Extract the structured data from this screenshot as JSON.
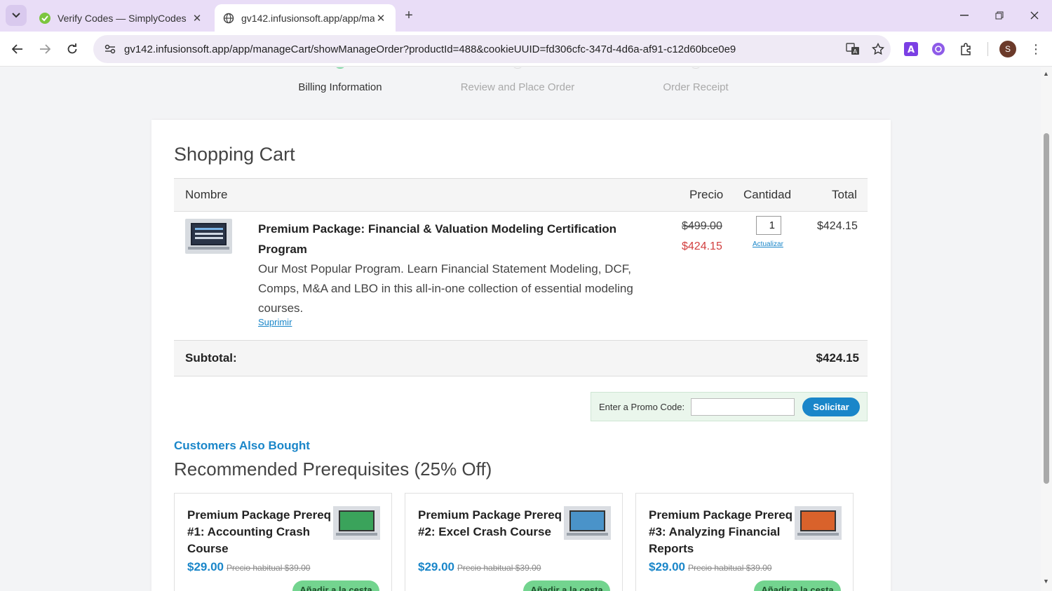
{
  "browser": {
    "tabs": [
      {
        "title": "Verify Codes — SimplyCodes",
        "active": false
      },
      {
        "title": "gv142.infusionsoft.app/app/ma",
        "active": true
      }
    ],
    "url": "gv142.infusionsoft.app/app/manageCart/showManageOrder?productId=488&cookieUUID=fd306cfc-347d-4d6a-af91-c12d60bce0e9",
    "avatar_initial": "S",
    "colors": {
      "tabbar": "#e9ddf7",
      "omnibox": "#efeaf5"
    }
  },
  "steps": [
    {
      "label": "Billing Information",
      "state": "done"
    },
    {
      "label": "Review and Place Order",
      "state": "todo"
    },
    {
      "label": "Order Receipt",
      "state": "todo"
    }
  ],
  "cart": {
    "title": "Shopping Cart",
    "columns": {
      "name": "Nombre",
      "price": "Precio",
      "quantity": "Cantidad",
      "total": "Total"
    },
    "item": {
      "name": "Premium Package: Financial & Valuation Modeling Certification Program",
      "description": "Our Most Popular Program. Learn Financial Statement Modeling, DCF, Comps, M&A and LBO in this all-in-one collection of essential modeling courses.",
      "delete_label": "Suprimir",
      "price_original": "$499.00",
      "price_sale": "$424.15",
      "quantity": "1",
      "update_label": "Actualizar",
      "line_total": "$424.15"
    },
    "subtotal_label": "Subtotal:",
    "subtotal_value": "$424.15",
    "promo": {
      "label": "Enter a Promo Code:",
      "value": "",
      "button": "Solicitar"
    }
  },
  "recommendations": {
    "kicker": "Customers Also Bought",
    "title": "Recommended Prerequisites (25% Off)",
    "items": [
      {
        "name": "Premium Package Prereq #1: Accounting Crash Course",
        "price": "$29.00",
        "regular": "Precio habitual $39.00",
        "button": "Añadir a la cesta",
        "screen_color": "#3aa35b"
      },
      {
        "name": "Premium Package Prereq #2: Excel Crash Course",
        "price": "$29.00",
        "regular": "Precio habitual $39.00",
        "button": "Añadir a la cesta",
        "screen_color": "#4a93c9"
      },
      {
        "name": "Premium Package Prereq #3: Analyzing Financial Reports",
        "price": "$29.00",
        "regular": "Precio habitual $39.00",
        "button": "Añadir a la cesta",
        "screen_color": "#d9622b"
      }
    ]
  },
  "theme": {
    "accent": "#1a86c9",
    "sale_red": "#d23f3f",
    "cart_green": "#73d48f"
  }
}
